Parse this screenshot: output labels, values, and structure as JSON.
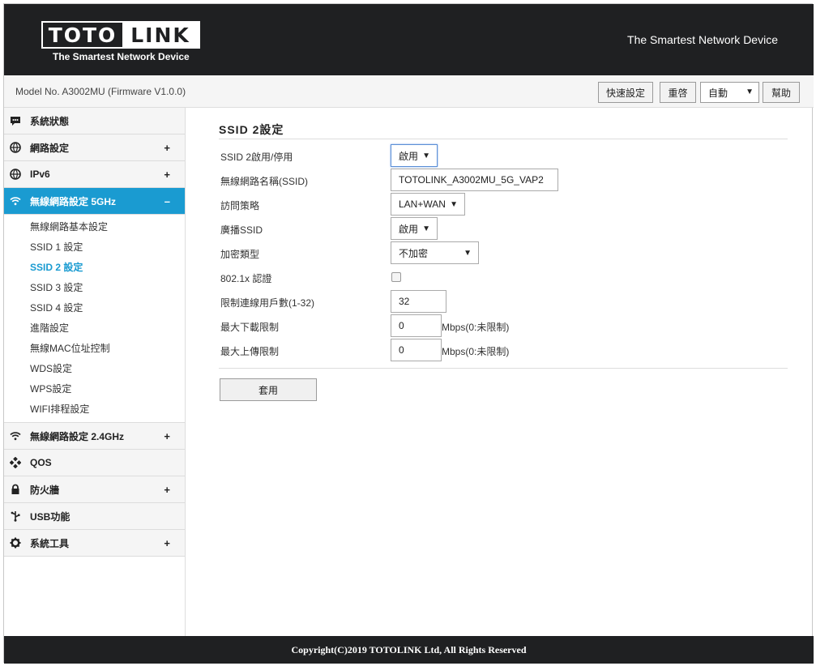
{
  "header": {
    "logo_left": "TOTO",
    "logo_right": "LINK",
    "logo_tagline": "The Smartest Network Device",
    "right_tagline": "The Smartest Network Device"
  },
  "model_bar": {
    "model_text": "Model No. A3002MU (Firmware V1.0.0)",
    "quick_setup": "快速設定",
    "reboot": "重啓",
    "language_selected": "自動",
    "help": "幫助"
  },
  "sidebar": {
    "items": [
      {
        "label": "系統狀態",
        "icon": "chat-icon",
        "toggle": ""
      },
      {
        "label": "網路設定",
        "icon": "globe-icon",
        "toggle": "+"
      },
      {
        "label": "IPv6",
        "icon": "globe-icon",
        "toggle": "+"
      },
      {
        "label": "無線網路設定 5GHz",
        "icon": "wifi-icon",
        "toggle": "–"
      },
      {
        "label": "無線網路設定 2.4GHz",
        "icon": "wifi-icon",
        "toggle": "+"
      },
      {
        "label": "QOS",
        "icon": "qos-icon",
        "toggle": ""
      },
      {
        "label": "防火牆",
        "icon": "lock-icon",
        "toggle": "+"
      },
      {
        "label": "USB功能",
        "icon": "usb-icon",
        "toggle": ""
      },
      {
        "label": "系統工具",
        "icon": "gear-icon",
        "toggle": "+"
      }
    ],
    "sub_items": [
      "無線網路基本設定",
      "SSID 1 設定",
      "SSID 2 設定",
      "SSID 3 設定",
      "SSID 4 設定",
      "進階設定",
      "無線MAC位址控制",
      "WDS設定",
      "WPS設定",
      "WIFI排程設定"
    ]
  },
  "form": {
    "title": "SSID 2設定",
    "enable_label": "SSID 2啟用/停用",
    "enable_value": "啟用",
    "ssid_label": "無線網路名稱(SSID)",
    "ssid_value": "TOTOLINK_A3002MU_5G_VAP2",
    "access_label": "訪問策略",
    "access_value": "LAN+WAN",
    "broadcast_label": "廣播SSID",
    "broadcast_value": "啟用",
    "encryption_label": "加密類型",
    "encryption_value": "不加密",
    "auth_label": "802.1x 認證",
    "max_clients_label": "限制連線用戶數(1-32)",
    "max_clients_value": "32",
    "download_label": "最大下載限制",
    "download_value": "0",
    "upload_label": "最大上傳限制",
    "upload_value": "0",
    "unit": "Mbps(0:未限制)",
    "apply": "套用"
  },
  "footer": {
    "copyright": "Copyright(C)2019 TOTOLINK Ltd, All Rights Reserved"
  }
}
